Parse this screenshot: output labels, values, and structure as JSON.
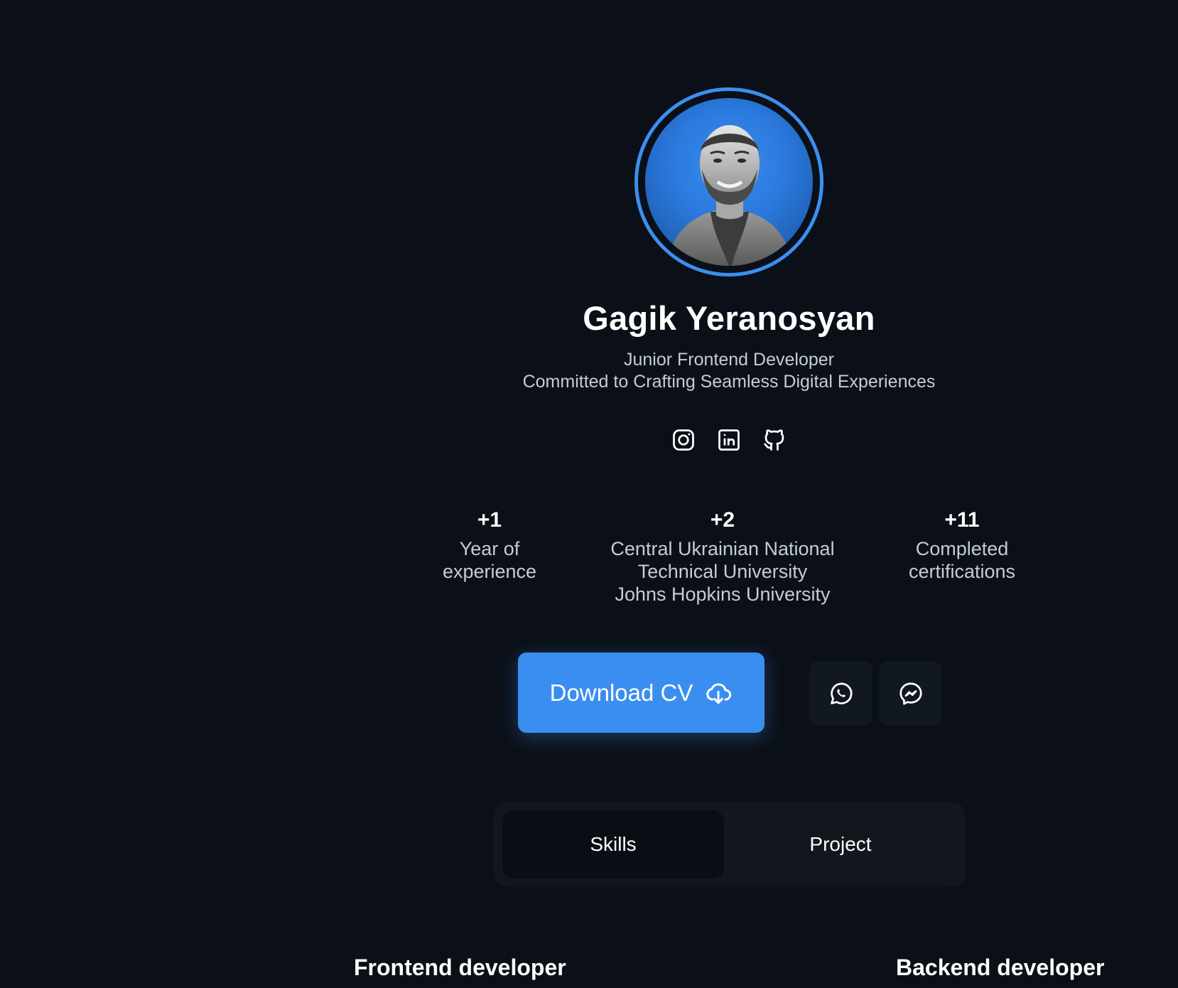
{
  "profile": {
    "name": "Gagik Yeranosyan",
    "tagline_line1": "Junior Frontend Developer",
    "tagline_line2": "Committed to Crafting Seamless Digital Experiences",
    "accent_color": "#3b8ff0"
  },
  "socials": [
    {
      "icon": "instagram-icon"
    },
    {
      "icon": "linkedin-icon"
    },
    {
      "icon": "github-icon"
    }
  ],
  "stats": [
    {
      "value": "+1",
      "label": "Year of\nexperience"
    },
    {
      "value": "+2",
      "label": "Central Ukrainian National\nTechnical University\nJohns Hopkins University"
    },
    {
      "value": "+11",
      "label": "Completed\ncertifications"
    }
  ],
  "actions": {
    "download_label": "Download CV",
    "download_icon": "cloud-download-icon",
    "whatsapp_icon": "whatsapp-icon",
    "messenger_icon": "messenger-icon"
  },
  "tabs": [
    {
      "label": "Skills",
      "active": true
    },
    {
      "label": "Project",
      "active": false
    }
  ],
  "sections": {
    "frontend_title": "Frontend developer",
    "backend_title": "Backend developer"
  }
}
